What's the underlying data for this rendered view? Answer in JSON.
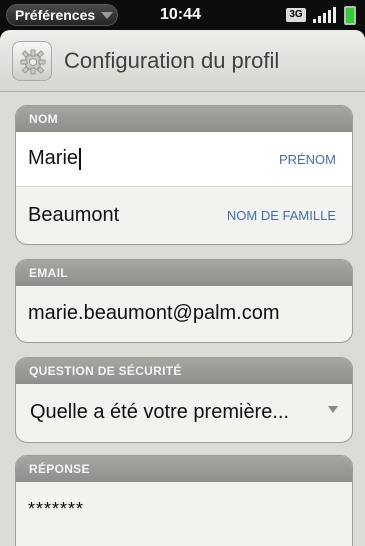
{
  "statusbar": {
    "app_menu_label": "Préférences",
    "time": "10:44",
    "network": "3G"
  },
  "header": {
    "title": "Configuration du profil",
    "icon": "gear-icon"
  },
  "sections": {
    "name": {
      "label": "NOM",
      "first_name": {
        "value": "Marie",
        "hint": "PRÉNOM"
      },
      "last_name": {
        "value": "Beaumont",
        "hint": "NOM DE FAMILLE"
      }
    },
    "email": {
      "label": "EMAIL",
      "value": "marie.beaumont@palm.com"
    },
    "security_question": {
      "label": "QUESTION DE SÉCURITÉ",
      "selected": "Quelle a été votre première..."
    },
    "answer": {
      "label": "RÉPONSE",
      "value": "*******"
    }
  },
  "colors": {
    "hint_blue": "#3f6fb2",
    "section_header": "#9a9a96",
    "battery": "#2fd12f"
  }
}
